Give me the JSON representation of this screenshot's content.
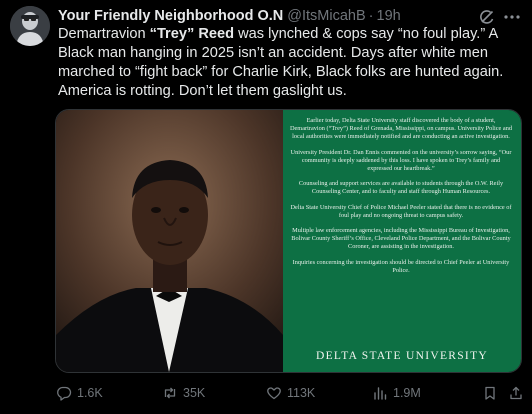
{
  "author": {
    "display_name": "Your Friendly Neighborhood O.N",
    "handle": "@ItsMicahB",
    "separator": "·",
    "time": "19h"
  },
  "tweet": {
    "text_before_name": "Demartravion ",
    "nickname": "“Trey” Reed",
    "text_after_name": " was lynched & cops say “no foul play.” A Black man hanging in 2025 isn’t an accident. Days after white men marched to “fight back” for Charlie Kirk, Black folks are hunted again. America is rotting. Don’t let them gaslight us."
  },
  "media": {
    "statement_paragraphs": [
      "Earlier today, Delta State University staff discovered the body of a student, Demartravion (“Trey”) Reed of Grenada, Mississippi, on campus. University Police and local authorities were immediately notified and are conducting an active investigation.",
      "University President Dr. Dan Ennis commented on the university’s sorrow saying, “Our community is deeply saddened by this loss. I have spoken to Trey’s family and expressed our heartbreak.”",
      "Counseling and support services are available to students through the O.W. Reily Counseling Center, and to faculty and staff through Human Resources.",
      "Delta State University Chief of Police Michael Peeler stated that there is no evidence of foul play and no ongoing threat to campus safety.",
      "Multiple law enforcement agencies, including the Mississippi Bureau of Investigation, Bolivar County Sheriff’s Office, Cleveland Police Department, and the Bolivar County Coroner, are assisting in the investigation.",
      "Inquiries concerning the investigation should be directed to Chief Peeler at University Police."
    ],
    "university_name": "DELTA STATE UNIVERSITY",
    "statement_bg_color": "#0d7044"
  },
  "actions": {
    "replies": "1.6K",
    "retweets": "35K",
    "likes": "113K",
    "views": "1.9M"
  },
  "icons": {
    "reply": "reply-icon",
    "retweet": "retweet-icon",
    "like": "heart-icon",
    "views": "views-icon",
    "bookmark": "bookmark-icon",
    "share": "share-icon",
    "grok": "grok-icon",
    "more": "more-icon"
  },
  "colors": {
    "background": "#000000",
    "primary_text": "#e7e9ea",
    "secondary_text": "#71767b",
    "border": "#2f3336"
  }
}
